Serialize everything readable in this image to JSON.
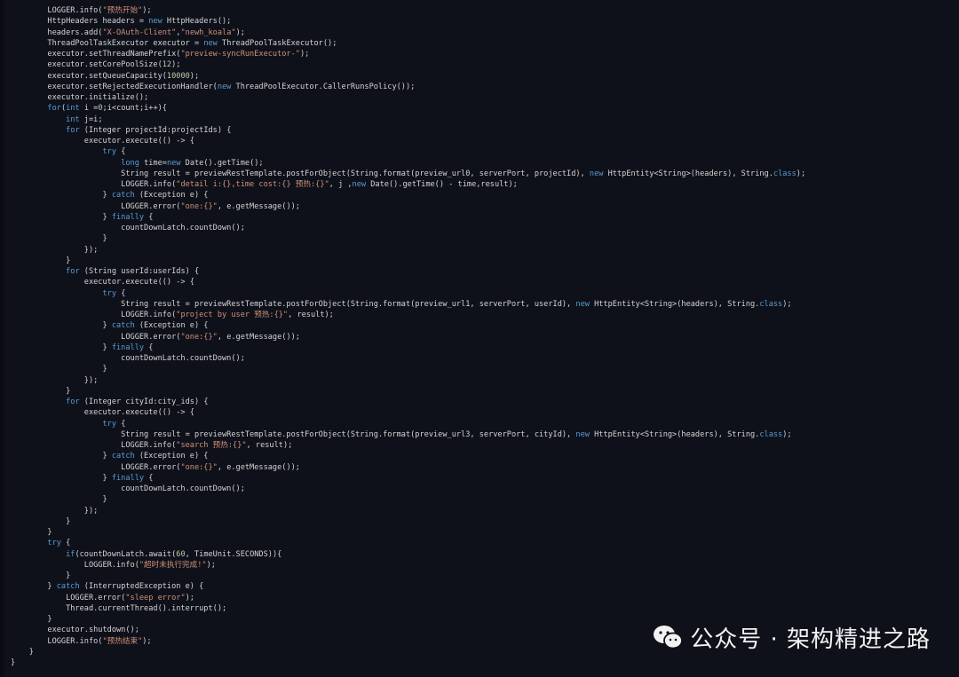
{
  "code": {
    "lines": [
      [
        {
          "t": "        LOGGER.info("
        },
        {
          "t": "\"预热开始\"",
          "c": "str"
        },
        {
          "t": ");"
        }
      ],
      [
        {
          "t": "        HttpHeaders headers = "
        },
        {
          "t": "new",
          "c": "kw"
        },
        {
          "t": " HttpHeaders();"
        }
      ],
      [
        {
          "t": "        headers.add("
        },
        {
          "t": "\"X-OAuth-Client\"",
          "c": "str"
        },
        {
          "t": ","
        },
        {
          "t": "\"newh_koala\"",
          "c": "str"
        },
        {
          "t": ");"
        }
      ],
      [
        {
          "t": "        ThreadPoolTaskExecutor executor = "
        },
        {
          "t": "new",
          "c": "kw"
        },
        {
          "t": " ThreadPoolTaskExecutor();"
        }
      ],
      [
        {
          "t": "        executor.setThreadNamePrefix("
        },
        {
          "t": "\"preview-syncRunExecutor-\"",
          "c": "str"
        },
        {
          "t": ");"
        }
      ],
      [
        {
          "t": "        executor.setCorePoolSize("
        },
        {
          "t": "12",
          "c": "num"
        },
        {
          "t": ");"
        }
      ],
      [
        {
          "t": "        executor.setQueueCapacity("
        },
        {
          "t": "10000",
          "c": "num"
        },
        {
          "t": ");"
        }
      ],
      [
        {
          "t": "        executor.setRejectedExecutionHandler("
        },
        {
          "t": "new",
          "c": "kw"
        },
        {
          "t": " ThreadPoolExecutor.CallerRunsPolicy());"
        }
      ],
      [
        {
          "t": "        executor.initialize();"
        }
      ],
      [
        {
          "t": "        "
        },
        {
          "t": "for",
          "c": "kw"
        },
        {
          "t": "("
        },
        {
          "t": "int",
          "c": "kw"
        },
        {
          "t": " i ="
        },
        {
          "t": "0",
          "c": "num"
        },
        {
          "t": ";i<count;i++){"
        }
      ],
      [
        {
          "t": "            "
        },
        {
          "t": "int",
          "c": "kw"
        },
        {
          "t": " j=i;"
        }
      ],
      [
        {
          "t": "            "
        },
        {
          "t": "for",
          "c": "kw"
        },
        {
          "t": " (Integer projectId:projectIds) {"
        }
      ],
      [
        {
          "t": "                executor.execute(() -> {"
        }
      ],
      [
        {
          "t": "                    "
        },
        {
          "t": "try",
          "c": "kw"
        },
        {
          "t": " {"
        }
      ],
      [
        {
          "t": "                        "
        },
        {
          "t": "long",
          "c": "kw"
        },
        {
          "t": " time="
        },
        {
          "t": "new",
          "c": "kw"
        },
        {
          "t": " Date().getTime();"
        }
      ],
      [
        {
          "t": "                        String result = previewRestTemplate.postForObject(String.format(preview_url0, serverPort, projectId), "
        },
        {
          "t": "new",
          "c": "kw"
        },
        {
          "t": " HttpEntity<String>(headers), String."
        },
        {
          "t": "class",
          "c": "kw"
        },
        {
          "t": ");"
        }
      ],
      [
        {
          "t": "                        LOGGER.info("
        },
        {
          "t": "\"detail i:{},time cost:{} 预热:{}\"",
          "c": "str"
        },
        {
          "t": ", j ,"
        },
        {
          "t": "new",
          "c": "kw"
        },
        {
          "t": " Date().getTime() - time,result);"
        }
      ],
      [
        {
          "t": "                    } "
        },
        {
          "t": "catch",
          "c": "kw"
        },
        {
          "t": " (Exception e) {"
        }
      ],
      [
        {
          "t": "                        LOGGER.error("
        },
        {
          "t": "\"one:{}\"",
          "c": "str"
        },
        {
          "t": ", e.getMessage());"
        }
      ],
      [
        {
          "t": "                    } "
        },
        {
          "t": "finally",
          "c": "kw"
        },
        {
          "t": " {"
        }
      ],
      [
        {
          "t": "                        countDownLatch.countDown();"
        }
      ],
      [
        {
          "t": "                    }"
        }
      ],
      [
        {
          "t": "                });"
        }
      ],
      [
        {
          "t": "            }"
        }
      ],
      [
        {
          "t": "            "
        },
        {
          "t": "for",
          "c": "kw"
        },
        {
          "t": " (String userId:userIds) {"
        }
      ],
      [
        {
          "t": "                executor.execute(() -> {"
        }
      ],
      [
        {
          "t": "                    "
        },
        {
          "t": "try",
          "c": "kw"
        },
        {
          "t": " {"
        }
      ],
      [
        {
          "t": "                        String result = previewRestTemplate.postForObject(String.format(preview_url1, serverPort, userId), "
        },
        {
          "t": "new",
          "c": "kw"
        },
        {
          "t": " HttpEntity<String>(headers), String."
        },
        {
          "t": "class",
          "c": "kw"
        },
        {
          "t": ");"
        }
      ],
      [
        {
          "t": "                        LOGGER.info("
        },
        {
          "t": "\"project by user 预热:{}\"",
          "c": "str"
        },
        {
          "t": ", result);"
        }
      ],
      [
        {
          "t": "                    } "
        },
        {
          "t": "catch",
          "c": "kw"
        },
        {
          "t": " (Exception e) {"
        }
      ],
      [
        {
          "t": "                        LOGGER.error("
        },
        {
          "t": "\"one:{}\"",
          "c": "str"
        },
        {
          "t": ", e.getMessage());"
        }
      ],
      [
        {
          "t": "                    } "
        },
        {
          "t": "finally",
          "c": "kw"
        },
        {
          "t": " {"
        }
      ],
      [
        {
          "t": "                        countDownLatch.countDown();"
        }
      ],
      [
        {
          "t": "                    }"
        }
      ],
      [
        {
          "t": "                });"
        }
      ],
      [
        {
          "t": "            }"
        }
      ],
      [
        {
          "t": "            "
        },
        {
          "t": "for",
          "c": "kw"
        },
        {
          "t": " (Integer cityId:city_ids) {"
        }
      ],
      [
        {
          "t": "                executor.execute(() -> {"
        }
      ],
      [
        {
          "t": "                    "
        },
        {
          "t": "try",
          "c": "kw"
        },
        {
          "t": " {"
        }
      ],
      [
        {
          "t": "                        String result = previewRestTemplate.postForObject(String.format(preview_url3, serverPort, cityId), "
        },
        {
          "t": "new",
          "c": "kw"
        },
        {
          "t": " HttpEntity<String>(headers), String."
        },
        {
          "t": "class",
          "c": "kw"
        },
        {
          "t": ");"
        }
      ],
      [
        {
          "t": "                        LOGGER.info("
        },
        {
          "t": "\"search 预热:{}\"",
          "c": "str"
        },
        {
          "t": ", result);"
        }
      ],
      [
        {
          "t": "                    } "
        },
        {
          "t": "catch",
          "c": "kw"
        },
        {
          "t": " (Exception e) {"
        }
      ],
      [
        {
          "t": "                        LOGGER.error("
        },
        {
          "t": "\"one:{}\"",
          "c": "str"
        },
        {
          "t": ", e.getMessage());"
        }
      ],
      [
        {
          "t": "                    } "
        },
        {
          "t": "finally",
          "c": "kw"
        },
        {
          "t": " {"
        }
      ],
      [
        {
          "t": "                        countDownLatch.countDown();"
        }
      ],
      [
        {
          "t": "                    }"
        }
      ],
      [
        {
          "t": "                });"
        }
      ],
      [
        {
          "t": "            }"
        }
      ],
      [
        {
          "t": "        }"
        }
      ],
      [
        {
          "t": "        "
        },
        {
          "t": "try",
          "c": "kw"
        },
        {
          "t": " {"
        }
      ],
      [
        {
          "t": "            "
        },
        {
          "t": "if",
          "c": "kw"
        },
        {
          "t": "(countDownLatch.await("
        },
        {
          "t": "60",
          "c": "num"
        },
        {
          "t": ", TimeUnit.SECONDS)){"
        }
      ],
      [
        {
          "t": "                LOGGER.info("
        },
        {
          "t": "\"超时未执行完成!\"",
          "c": "str"
        },
        {
          "t": ");"
        }
      ],
      [
        {
          "t": "            }"
        }
      ],
      [
        {
          "t": "        } "
        },
        {
          "t": "catch",
          "c": "kw"
        },
        {
          "t": " (InterruptedException e) {"
        }
      ],
      [
        {
          "t": "            LOGGER.error("
        },
        {
          "t": "\"sleep error\"",
          "c": "str"
        },
        {
          "t": ");"
        }
      ],
      [
        {
          "t": "            Thread.currentThread().interrupt();"
        }
      ],
      [
        {
          "t": "        }"
        }
      ],
      [
        {
          "t": "        executor.shutdown();"
        }
      ],
      [
        {
          "t": "        LOGGER.info("
        },
        {
          "t": "\"预热结束\"",
          "c": "str"
        },
        {
          "t": ");"
        }
      ],
      [
        {
          "t": "    }"
        }
      ],
      [
        {
          "t": "}"
        }
      ]
    ]
  },
  "watermark": {
    "text": "公众号 · 架构精进之路",
    "icon": "wechat-icon"
  }
}
